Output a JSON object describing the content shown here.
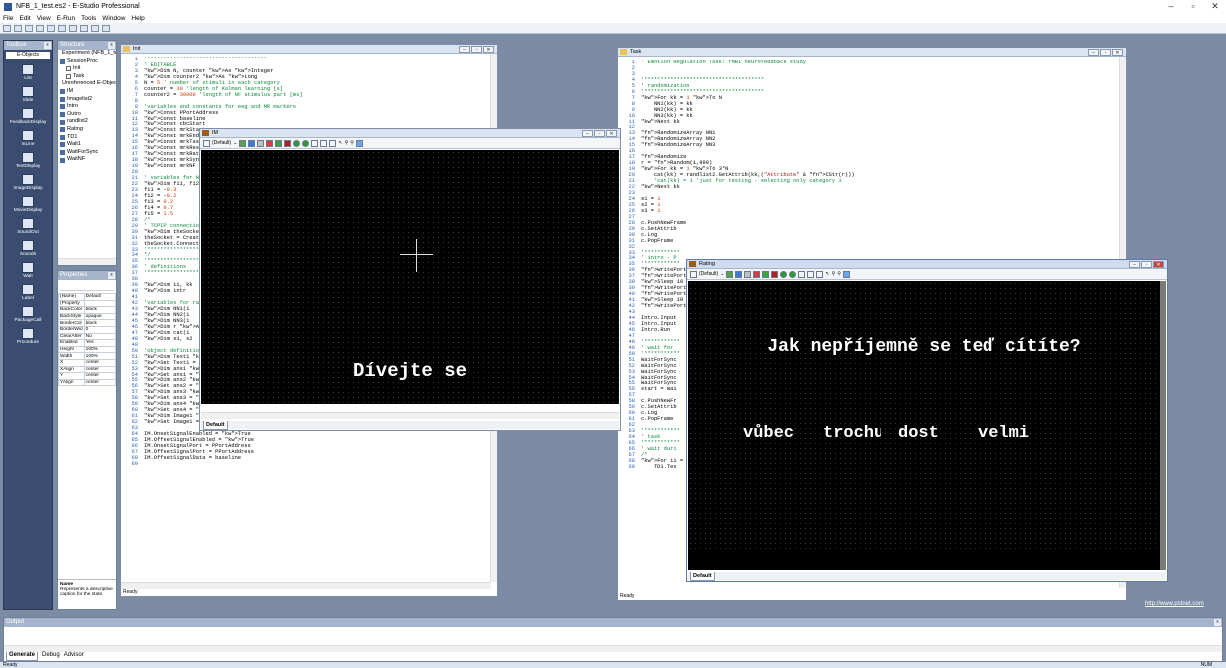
{
  "app": {
    "title": "NFB_1_test.es2 - E-Studio Professional"
  },
  "window_controls": {
    "minimize": "–",
    "maximize": "▫",
    "close": "✕"
  },
  "menu": [
    "File",
    "Edit",
    "View",
    "E-Run",
    "Tools",
    "Window",
    "Help"
  ],
  "toolbox": {
    "title": "Toolbox",
    "tab": "E-Objects",
    "items": [
      "List",
      "Slide",
      "FeedbackDisplay",
      "InLine",
      "TextDisplay",
      "ImageDisplay",
      "MovieDisplay",
      "SoundOut",
      "Sounds",
      "Wait",
      "Label",
      "PackageCall",
      "Procedure"
    ]
  },
  "structure": {
    "title": "Structure",
    "items": [
      {
        "label": "Experiment (NFB_1_test)",
        "indent": 0
      },
      {
        "label": "SessionProc",
        "indent": 0
      },
      {
        "label": "Init",
        "indent": 1
      },
      {
        "label": "Task",
        "indent": 1
      },
      {
        "label": "Unreferenced E-Objects",
        "indent": 0
      },
      {
        "label": "IM",
        "indent": 0
      },
      {
        "label": "Imagelist2",
        "indent": 0
      },
      {
        "label": "Intro",
        "indent": 0
      },
      {
        "label": "Outro",
        "indent": 0
      },
      {
        "label": "randlist2",
        "indent": 0
      },
      {
        "label": "Rating",
        "indent": 0
      },
      {
        "label": "TD1",
        "indent": 0
      },
      {
        "label": "Wait1",
        "indent": 0
      },
      {
        "label": "WaitForSync",
        "indent": 0
      },
      {
        "label": "WaitNF",
        "indent": 0
      }
    ]
  },
  "properties": {
    "title": "Properties",
    "rows": [
      [
        "(Name)",
        "Default"
      ],
      [
        "(Property",
        ""
      ],
      [
        "BackColor",
        "black"
      ],
      [
        "BackStyle",
        "opaque"
      ],
      [
        "BorderCol",
        "black"
      ],
      [
        "BorderWid",
        "0"
      ],
      [
        "ClearAfter",
        "No"
      ],
      [
        "Enabled",
        "Yes"
      ],
      [
        "Height",
        "100%"
      ],
      [
        "Width",
        "100%"
      ],
      [
        "X",
        "center"
      ],
      [
        "XAlign",
        "center"
      ],
      [
        "Y",
        "center"
      ],
      [
        "YAlign",
        "center"
      ]
    ],
    "desc_name": "Name",
    "desc_text": "Represents a descriptive caption for the state."
  },
  "editor_left": {
    "title": "Init",
    "lines": [
      "'*************************************",
      "' EDITABLE",
      "Dim N, counter As Integer",
      "Dim counter2 As Long",
      "N = 5 ' number of stimuli in each category",
      "counter = 30 'length of Kalman learning [s]",
      "counter2 = 30000 'length of NF stimulus part [ms]",
      "",
      "'variables and constants for eeg and MR markers",
      "Const PPortAddress",
      "Const baseline",
      "Const cbcStart",
      "Const mrkStart",
      "Const mrkEnd",
      "Const mrkTask",
      "Const mrkRest",
      "Const mrkRating",
      "Const mrkSync",
      "Const mrkNF",
      "",
      "' variables for NF",
      "Dim fi1, fi2",
      "fi1 = -0.3",
      "fi2 = -0.2",
      "fi3 = 0.2",
      "fi4 = 0.7",
      "fi5 = 1.5",
      "/*",
      "' TCPIP connection",
      "Dim theSocket",
      "theSocket = CreateSocket",
      "theSocket.Connect",
      "'******************",
      "*/",
      "'******************",
      "' definitions",
      "'******************",
      "",
      "Dim ii, kk",
      "Dim intr",
      "",
      "'variables for randomization",
      "Dim NN1(1",
      "Dim NN2(1",
      "Dim NN3(1",
      "Dim r As",
      "Dim cat(1",
      "Dim s1, s2",
      "",
      "'object definitions",
      "Dim Text1 As SlideText",
      "Set Text1 = CSlideText(IM.States(IM.ActiveState).Objects(\"Text1\"))",
      "Dim ans1 As SlideText",
      "Set ans1 = CSlideText(Rating.States(Rating.ActiveState).Objects(\"ans1\"))",
      "Dim ans2 As SlideText",
      "Set ans2 = CSlideText(Rating.States(Rating.ActiveState).Objects(\"ans2\"))",
      "Dim ans3 As SlideText",
      "Set ans3 = CSlideText(Rating.States(Rating.ActiveState).Objects(\"ans3\"))",
      "Dim ans4 As SlideText",
      "Set ans4 = CSlideText(Rating.States(Rating.ActiveState).Objects(\"ans4\"))",
      "Dim Image1 As SlideImage",
      "Set Image1 = CSlideImage(IM.States(IM.ActiveState).Objects(\"Image1\"))",
      "",
      "IM.OnsetSignalEnabled = True",
      "IM.OffsetSignalEnabled = True",
      "IM.OnsetSignalPort = PPortAddress",
      "IM.OffsetSignalPort = PPortAddress",
      "IM.OffsetSignalData = baseline",
      ""
    ],
    "status": "Ready"
  },
  "editor_right": {
    "title": "Task",
    "lines": [
      "' Emotion Regulation Task: fMRI neurofeedback study",
      "",
      "",
      "'*************************************",
      "' randomization",
      "'*************************************",
      "For kk = 1 To N",
      "    NN1(kk) = kk",
      "    NN2(kk) = kk",
      "    NN3(kk) = kk",
      "Next kk",
      "",
      "RandomizeArray NN1",
      "RandomizeArray NN2",
      "RandomizeArray NN3",
      "",
      "Randomize",
      "r = Random(1,999)",
      "For kk = 1 To 3*N",
      "    cat(kk) = randlist2.GetAttrib(kk,(\"Attribute\" & CStr(r)))",
      "    'cat(kk) = 1 'just for testing - selecting only category 1",
      "Next kk",
      "",
      "s1 = 1",
      "s2 = 1",
      "s3 = 1",
      "",
      "c.PushNewFrame",
      "c.SetAttrib",
      "c.Log",
      "c.PopFrame",
      "",
      "'***********",
      "' intro - P",
      "'***********",
      "WritePort P",
      "WritePort P",
      "Sleep 10",
      "WritePort P",
      "WritePort P",
      "Sleep 10",
      "WritePort P",
      "",
      "Intro.Input",
      "Intro.Input",
      "Intro.Run",
      "",
      "'***********",
      "' wait for",
      "'***********",
      "WaitForSync",
      "WaitForSync",
      "WaitForSync",
      "WaitForSync",
      "WaitForSync",
      "start = Wai",
      "",
      "c.PushNewFr",
      "c.SetAttrib",
      "c.Log",
      "c.PopFrame",
      "",
      "'***********",
      "' task",
      "'***********",
      "' wait duri",
      "/*",
      "For ii = 0",
      "    TD1.Tex"
    ],
    "status": "Ready"
  },
  "preview_im": {
    "title": "IM",
    "state": "(Default)",
    "text": "Dívejte se",
    "tab": "Default"
  },
  "preview_rating": {
    "title": "Rating",
    "state": "(Default)",
    "question": "Jak nepříjemně se teď cítíte?",
    "answers": [
      "vůbec",
      "trochu",
      "dost",
      "velmi"
    ],
    "tab": "Default"
  },
  "link": {
    "text": "http://www.pstnet.com"
  },
  "output": {
    "title": "Output",
    "tabs": [
      "Generate",
      "Debug",
      "Advisor"
    ]
  },
  "statusbar": {
    "left": "Ready",
    "right": "NUM"
  }
}
